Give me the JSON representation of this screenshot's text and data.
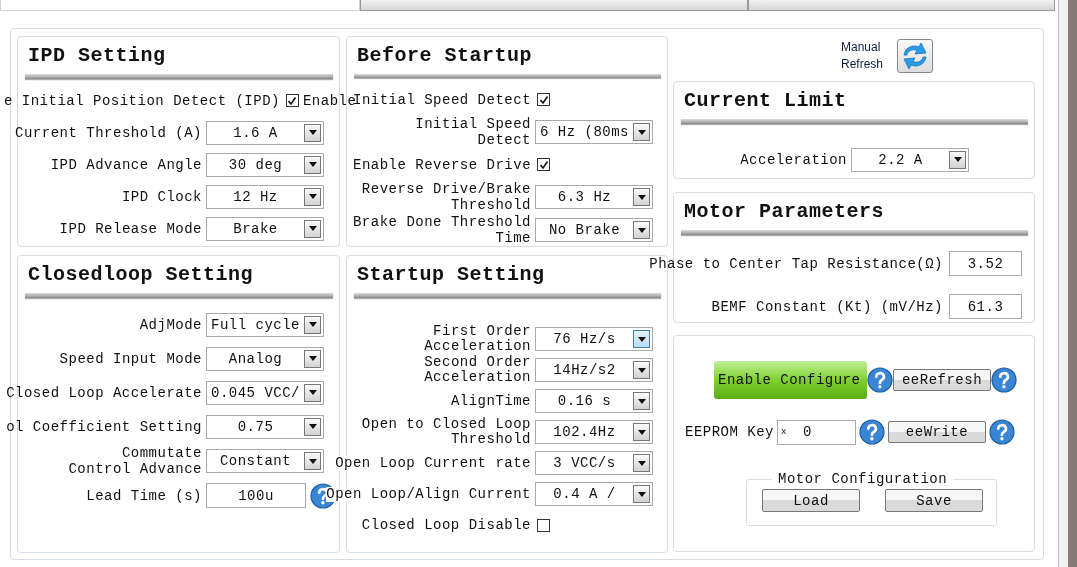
{
  "tabs": [
    {
      "selected": true
    },
    {
      "selected": false
    },
    {
      "selected": false
    }
  ],
  "panels": [
    {
      "title": "IPD Setting",
      "rows": [
        {
          "kind": "checkbox",
          "label": "e Initial Position Detect (IPD)",
          "checked": true,
          "suffix": "Enable"
        },
        {
          "kind": "select",
          "label": "Current Threshold (A)",
          "value": "1.6 A",
          "highlighted": false
        },
        {
          "kind": "select",
          "label": "IPD Advance Angle",
          "value": "30 deg",
          "highlighted": false
        },
        {
          "kind": "select",
          "label": "IPD Clock",
          "value": "12 Hz",
          "highlighted": false
        },
        {
          "kind": "select",
          "label": "IPD Release Mode",
          "value": "Brake",
          "highlighted": false
        }
      ]
    },
    {
      "title": "Before Startup",
      "rows": [
        {
          "kind": "checkbox",
          "label": "Initial Speed Detect",
          "checked": true
        },
        {
          "kind": "select",
          "label": "Initial Speed\nDetect",
          "value": "6 Hz (80ms",
          "highlighted": false
        },
        {
          "kind": "checkbox",
          "label": "Enable Reverse Drive",
          "checked": true
        },
        {
          "kind": "select",
          "label": "Reverse Drive/Brake\nThreshold",
          "value": "6.3 Hz",
          "highlighted": false
        },
        {
          "kind": "select",
          "label": "Brake Done Threshold\nTime",
          "value": "No Brake",
          "highlighted": false
        }
      ]
    },
    {
      "title": "Closedloop Setting",
      "rows": [
        {
          "kind": "select",
          "label": "AdjMode",
          "value": "Full cycle",
          "highlighted": false
        },
        {
          "kind": "select",
          "label": "Speed Input Mode",
          "value": "Analog",
          "highlighted": false
        },
        {
          "kind": "select",
          "label": "Closed Loop Accelerate",
          "value": "0.045 VCC/",
          "highlighted": false
        },
        {
          "kind": "select",
          "label": "ol Coefficient Setting",
          "value": "0.75",
          "highlighted": false
        },
        {
          "kind": "select",
          "label": "Commutate\nControl Advance",
          "value": "Constant",
          "highlighted": false
        },
        {
          "kind": "input",
          "label": "Lead Time (s)",
          "value": "100u",
          "help": true
        }
      ]
    },
    {
      "title": "Startup Setting",
      "rows": [
        {
          "kind": "select",
          "label": "First Order\nAcceleration",
          "value": "76 Hz/s",
          "highlighted": true
        },
        {
          "kind": "select",
          "label": "Second Order\nAcceleration",
          "value": "14Hz/s2",
          "highlighted": false
        },
        {
          "kind": "select",
          "label": "AlignTime",
          "value": "0.16 s",
          "highlighted": false
        },
        {
          "kind": "select",
          "label": "Open to Closed Loop\nThreshold",
          "value": "102.4Hz",
          "highlighted": false
        },
        {
          "kind": "select",
          "label": "Open Loop Current rate",
          "value": "3 VCC/s",
          "highlighted": false
        },
        {
          "kind": "select",
          "label": "Open Loop/Align Current",
          "value": "0.4 A /",
          "highlighted": false
        },
        {
          "kind": "checkbox",
          "label": "Closed Loop Disable",
          "checked": false
        }
      ]
    }
  ],
  "manual_refresh": {
    "label": "Manual Refresh"
  },
  "current_limit": {
    "title": "Current Limit",
    "rows": [
      {
        "kind": "select",
        "label": "Acceleration",
        "value": "2.2 A",
        "highlighted": false
      }
    ]
  },
  "motor_parameters": {
    "title": "Motor Parameters",
    "rows": [
      {
        "kind": "input",
        "label": "Phase to Center Tap Resistance(Ω)",
        "value": "3.52"
      },
      {
        "kind": "input",
        "label": "BEMF Constant (Kt) (mV/Hz)",
        "value": "61.3"
      }
    ]
  },
  "configure": {
    "enable_button": "Enable Configure",
    "refresh_button": "eeRefresh",
    "key_label": "EEPROM Key",
    "key_prefix": "x",
    "key_value": "0",
    "write_button": "eeWrite",
    "group": {
      "title": "Motor Configuration",
      "buttons": [
        "Load",
        "Save"
      ]
    }
  }
}
